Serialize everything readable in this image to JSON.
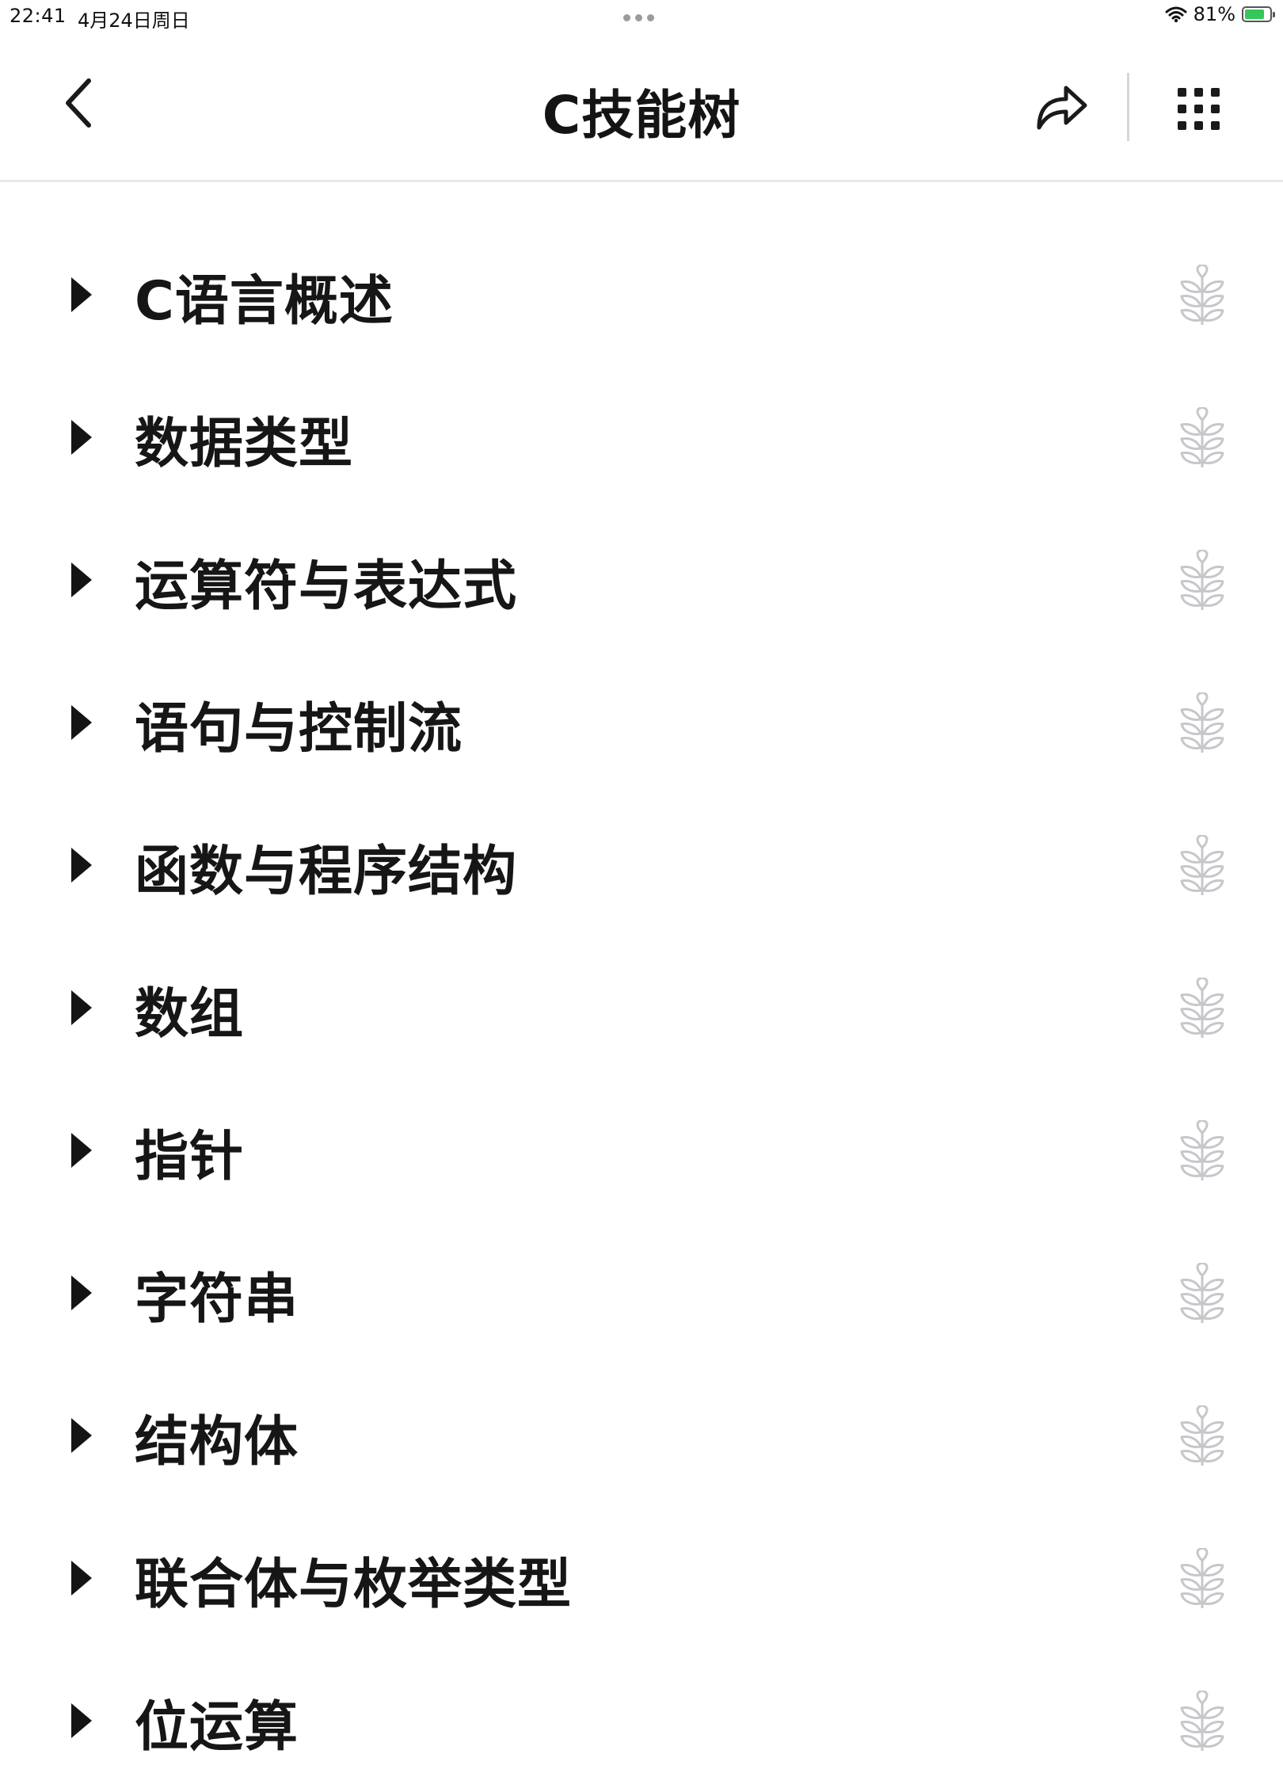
{
  "status_bar": {
    "time": "22:41",
    "date": "4月24日周日",
    "battery_percent": "81%",
    "battery_level": 0.81,
    "battery_color": "#35c759"
  },
  "nav": {
    "back_icon": "chevron-left-icon",
    "title": "C技能树",
    "share_icon": "share-icon",
    "more_icon": "grid-menu-icon"
  },
  "skills": [
    {
      "label": "C语言概述"
    },
    {
      "label": "数据类型"
    },
    {
      "label": "运算符与表达式"
    },
    {
      "label": "语句与控制流"
    },
    {
      "label": "函数与程序结构"
    },
    {
      "label": "数组"
    },
    {
      "label": "指针"
    },
    {
      "label": "字符串"
    },
    {
      "label": "结构体"
    },
    {
      "label": "联合体与枚举类型"
    },
    {
      "label": "位运算"
    }
  ],
  "colors": {
    "text": "#161616",
    "leaf_icon": "#9a9aa2",
    "divider": "#e8e8ea"
  }
}
